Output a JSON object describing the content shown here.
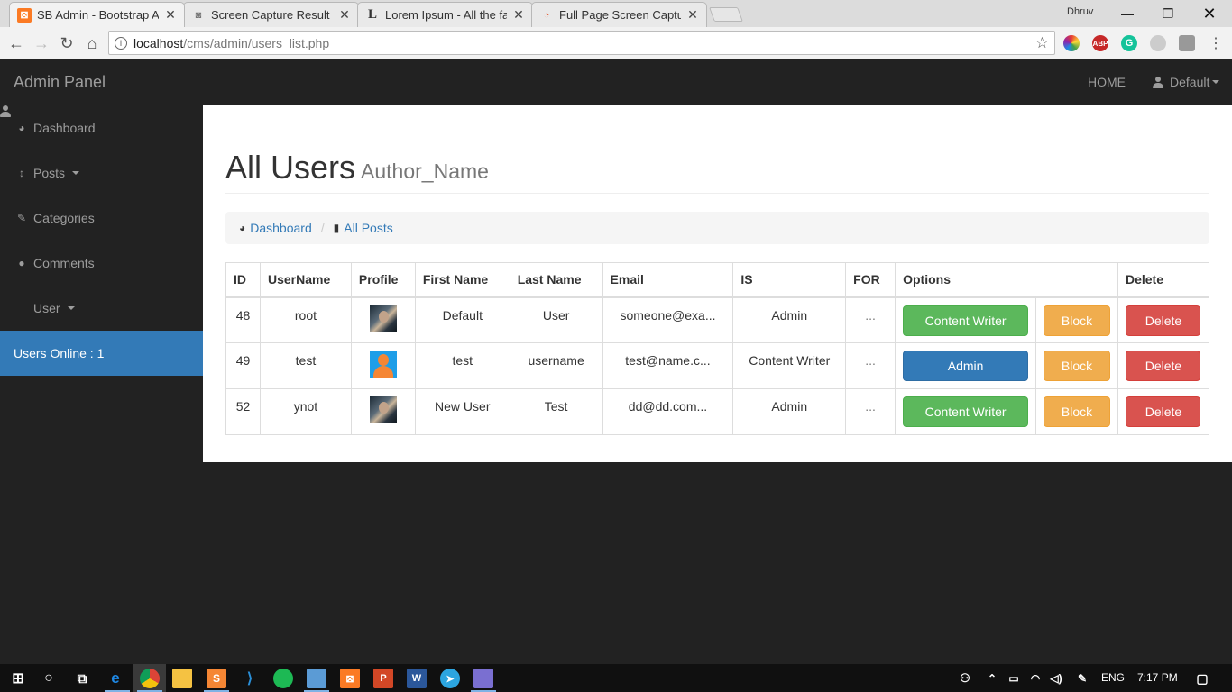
{
  "browser": {
    "tabs": [
      {
        "title": "SB Admin - Bootstrap Ad",
        "favicon": "xampp-icon",
        "active": true
      },
      {
        "title": "Screen Capture Result",
        "favicon": "camera-icon",
        "active": false
      },
      {
        "title": "Lorem Ipsum - All the fac",
        "favicon": "lorem-icon",
        "active": false
      },
      {
        "title": "Full Page Screen Capture",
        "favicon": "chrome-ext-icon",
        "active": false
      }
    ],
    "profile_name": "Dhruv",
    "url_host": "localhost",
    "url_path": "/cms/admin/users_list.php"
  },
  "navbar": {
    "brand": "Admin Panel",
    "home_label": "HOME",
    "user_label": "Default"
  },
  "sidebar": {
    "items": [
      {
        "label": "Dashboard",
        "icon": "dashboard-icon"
      },
      {
        "label": "Posts",
        "icon": "arrows-vertical-icon",
        "dropdown": true
      },
      {
        "label": "Categories",
        "icon": "wrench-icon"
      },
      {
        "label": "Comments",
        "icon": "comment-icon"
      },
      {
        "label": "User",
        "icon": "user-icon",
        "dropdown": true
      }
    ],
    "online_label": "Users Online : 1"
  },
  "page": {
    "title": "All Users",
    "subtitle": "Author_Name"
  },
  "breadcrumb": {
    "dashboard": "Dashboard",
    "all_posts": "All Posts"
  },
  "table": {
    "headers": {
      "id": "ID",
      "username": "UserName",
      "profile": "Profile",
      "first_name": "First Name",
      "last_name": "Last Name",
      "email": "Email",
      "is": "IS",
      "for": "FOR",
      "options": "Options",
      "delete": "Delete"
    },
    "rows": [
      {
        "id": "48",
        "username": "root",
        "avatar": "photo",
        "first_name": "Default",
        "last_name": "User",
        "email": "someone@exa...",
        "is": "Admin",
        "for": "...",
        "option_btn": "Content Writer",
        "option_style": "success",
        "block": "Block",
        "delete": "Delete"
      },
      {
        "id": "49",
        "username": "test",
        "avatar": "default",
        "first_name": "test",
        "last_name": "username",
        "email": "test@name.c...",
        "is": "Content Writer",
        "for": "...",
        "option_btn": "Admin",
        "option_style": "primary",
        "block": "Block",
        "delete": "Delete"
      },
      {
        "id": "52",
        "username": "ynot",
        "avatar": "photo",
        "first_name": "New User",
        "last_name": "Test",
        "email": "dd@dd.com...",
        "is": "Admin",
        "for": "...",
        "option_btn": "Content Writer",
        "option_style": "success",
        "block": "Block",
        "delete": "Delete"
      }
    ]
  },
  "taskbar": {
    "language": "ENG",
    "time": "7:17 PM"
  },
  "colors": {
    "primary": "#337ab7",
    "success": "#5cb85c",
    "warning": "#f0ad4e",
    "danger": "#d9534f",
    "navbar_bg": "#222222"
  }
}
